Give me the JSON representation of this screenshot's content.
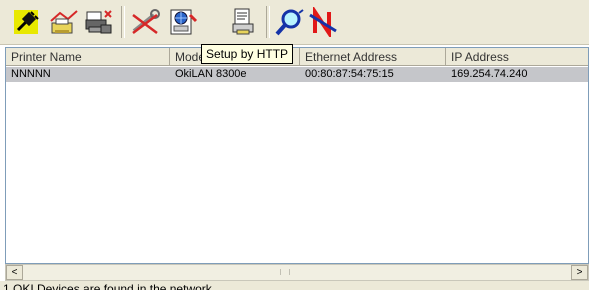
{
  "toolbar": {
    "buttons": [
      {
        "name": "plug-icon"
      },
      {
        "name": "printer-network-icon"
      },
      {
        "name": "printer-settings-icon"
      },
      {
        "name": "wrench-disconnect-icon"
      },
      {
        "name": "web-page-setup-icon"
      },
      {
        "name": "printer-list-icon"
      },
      {
        "name": "search-network-icon"
      },
      {
        "name": "exit-icon"
      }
    ]
  },
  "tooltip": {
    "text": "Setup by HTTP"
  },
  "table": {
    "columns": [
      "Printer Name",
      "Model",
      "Ethernet Address",
      "IP Address"
    ],
    "rows": [
      [
        "NNNNN",
        "OkiLAN 8300e",
        "00:80:87:54:75:15",
        "169.254.74.240"
      ]
    ]
  },
  "scrollbar": {
    "left_arrow": "<",
    "right_arrow": ">"
  },
  "status": {
    "text": "1 OKI Devices are found in the network."
  },
  "colors": {
    "toolbar_bg": "#ece9d8",
    "selected_row": "#c5c6ca",
    "tooltip_bg": "#ffffe1"
  }
}
